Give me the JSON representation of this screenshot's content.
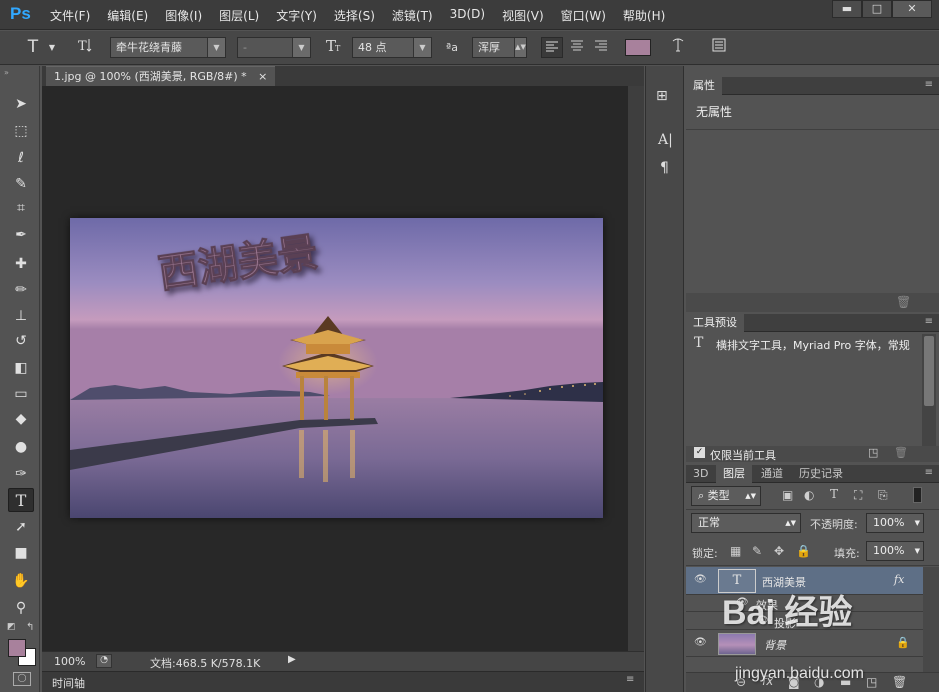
{
  "app": {
    "logo": "Ps"
  },
  "menubar": {
    "items": [
      "文件(F)",
      "编辑(E)",
      "图像(I)",
      "图层(L)",
      "文字(Y)",
      "选择(S)",
      "滤镜(T)",
      "3D(D)",
      "视图(V)",
      "窗口(W)",
      "帮助(H)"
    ]
  },
  "window_buttons": {
    "minimize": "▬",
    "restore": "□",
    "close": "✕"
  },
  "options": {
    "tool_glyph": "T",
    "font_family": "牵牛花绕青藤",
    "font_style": "-",
    "font_size": "48 点",
    "aa_glyph": "ªa",
    "antialias": "浑厚",
    "text_color": "#a8819c"
  },
  "document": {
    "tab_title": "1.jpg @ 100% (西湖美景, RGB/8#) *",
    "tab_close": "×",
    "overlay_text": "西湖美景",
    "zoom": "100%",
    "doc_size": "文档:468.5 K/578.1K"
  },
  "timeline": {
    "label": "时间轴"
  },
  "tools": {
    "foreground_color": "#a8819c",
    "background_color": "#ffffff",
    "active_tool": "type-tool"
  },
  "properties_panel": {
    "tab": "属性",
    "body": "无属性"
  },
  "tool_presets_panel": {
    "tab": "工具预设",
    "item_glyph": "T",
    "item": "横排文字工具，Myriad Pro 字体，常规",
    "current_only_label": "仅限当前工具"
  },
  "layers_panel": {
    "tabs": [
      "3D",
      "图层",
      "通道",
      "历史记录"
    ],
    "active_tab": "图层",
    "filter_kind": "类型",
    "blend_mode": "正常",
    "opacity_label": "不透明度:",
    "opacity_value": "100%",
    "lock_label": "锁定:",
    "fill_label": "填充:",
    "fill_value": "100%",
    "layers": [
      {
        "name": "西湖美景",
        "fx": "fx",
        "selected": true,
        "effects_label": "效果",
        "sub_effect": "投影"
      },
      {
        "name": "背景",
        "selected": false
      }
    ]
  },
  "watermark": {
    "brand": "Bai 经验",
    "url": "jingyan.baidu.com"
  }
}
